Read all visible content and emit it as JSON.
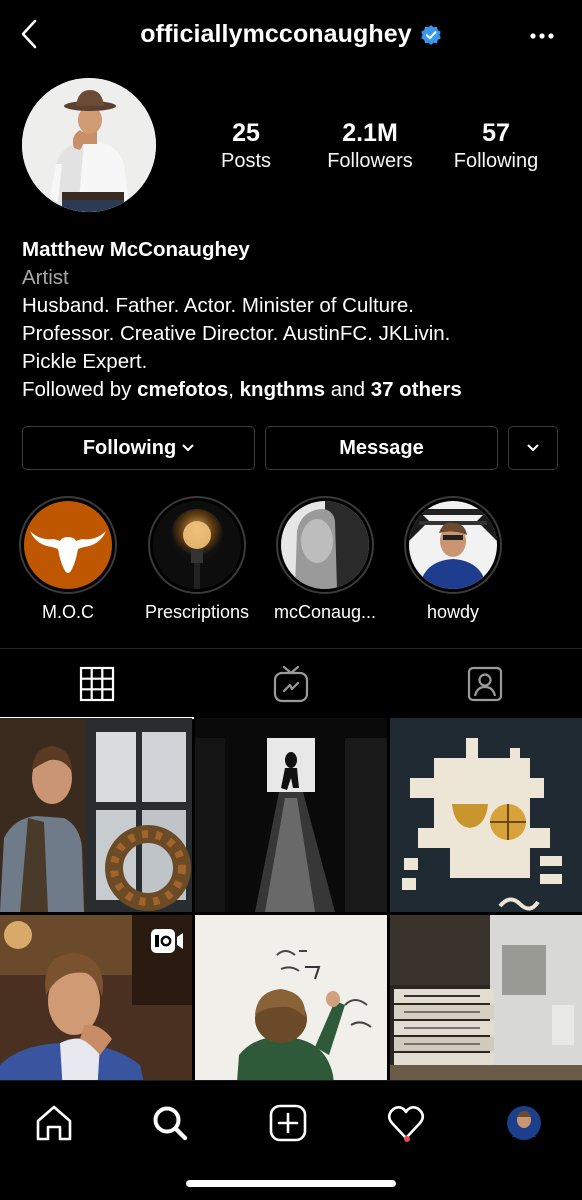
{
  "header": {
    "username": "officiallymcconaughey",
    "verified_color": "#3897f0"
  },
  "stats": {
    "posts_count": "25",
    "posts_label": "Posts",
    "followers_count": "2.1M",
    "followers_label": "Followers",
    "following_count": "57",
    "following_label": "Following"
  },
  "bio": {
    "name": "Matthew McConaughey",
    "category": "Artist",
    "line1": "Husband. Father. Actor. Minister of Culture.",
    "line2": "Professor. Creative Director. AustinFC. JKLivin.",
    "line3": "Pickle Expert.",
    "followed_by_prefix": "Followed by ",
    "followed_by_user1": "cmefotos",
    "followed_by_sep": ", ",
    "followed_by_user2": "kngthms",
    "followed_by_and": " and ",
    "followed_by_others": "37 others"
  },
  "actions": {
    "following_label": "Following",
    "message_label": "Message"
  },
  "highlights": [
    {
      "label": "M.O.C",
      "icon": "longhorn-icon",
      "color": "#bf5700"
    },
    {
      "label": "Prescriptions",
      "icon": "lightbulb-image"
    },
    {
      "label": "mcConaug...",
      "icon": "portrait-image"
    },
    {
      "label": "howdy",
      "icon": "selfie-image"
    }
  ],
  "tabs": [
    "grid-tab",
    "igtv-tab",
    "tagged-tab"
  ],
  "posts": [
    {
      "type": "photo"
    },
    {
      "type": "photo"
    },
    {
      "type": "photo"
    },
    {
      "type": "video"
    },
    {
      "type": "photo"
    },
    {
      "type": "photo"
    }
  ],
  "bottom_nav": [
    "home-icon",
    "search-icon",
    "new-post-icon",
    "activity-icon",
    "profile-avatar"
  ],
  "colors": {
    "background": "#000000",
    "muted_text": "#a8a8a8",
    "notification_dot": "#ed4956",
    "texas_orange": "#bf5700"
  }
}
